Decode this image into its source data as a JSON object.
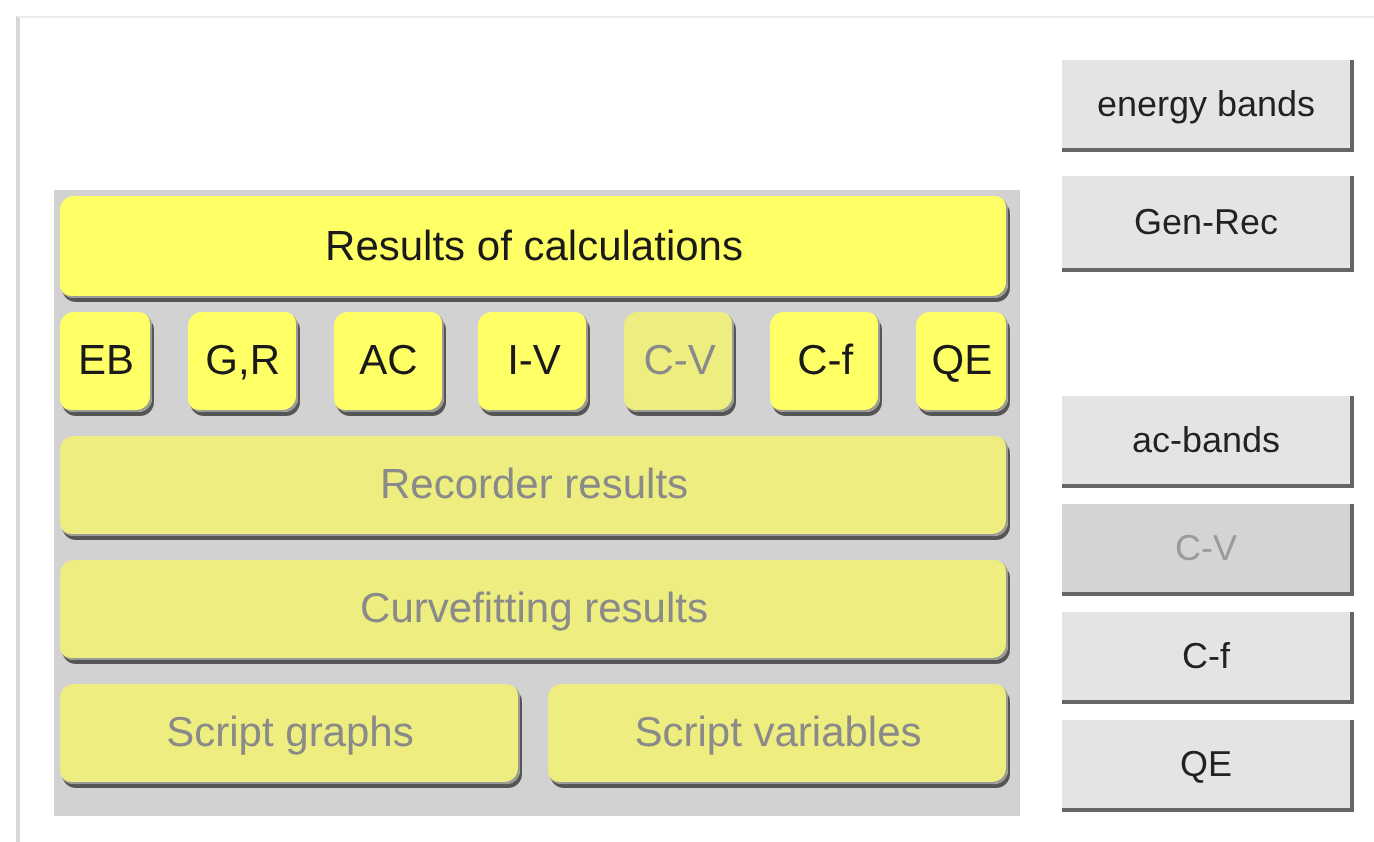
{
  "panel": {
    "title": {
      "label": "Results of calculations",
      "disabled": false
    },
    "small_buttons": [
      {
        "label": "EB",
        "disabled": false
      },
      {
        "label": "G,R",
        "disabled": false
      },
      {
        "label": "AC",
        "disabled": false
      },
      {
        "label": "I-V",
        "disabled": false
      },
      {
        "label": "C-V",
        "disabled": true
      },
      {
        "label": "C-f",
        "disabled": false
      },
      {
        "label": "QE",
        "disabled": false
      }
    ],
    "wide_buttons": [
      {
        "label": "Recorder results",
        "disabled": true
      },
      {
        "label": "Curvefitting results",
        "disabled": true
      }
    ],
    "script_buttons": [
      {
        "label": "Script graphs",
        "disabled": true
      },
      {
        "label": "Script variables",
        "disabled": true
      }
    ]
  },
  "side_buttons_top": [
    {
      "label": "energy bands",
      "disabled": false
    },
    {
      "label": "Gen-Rec",
      "disabled": false
    }
  ],
  "side_buttons_bottom": [
    {
      "label": "ac-bands",
      "disabled": false
    },
    {
      "label": "C-V",
      "disabled": true
    },
    {
      "label": "C-f",
      "disabled": false
    },
    {
      "label": "QE",
      "disabled": false
    }
  ]
}
